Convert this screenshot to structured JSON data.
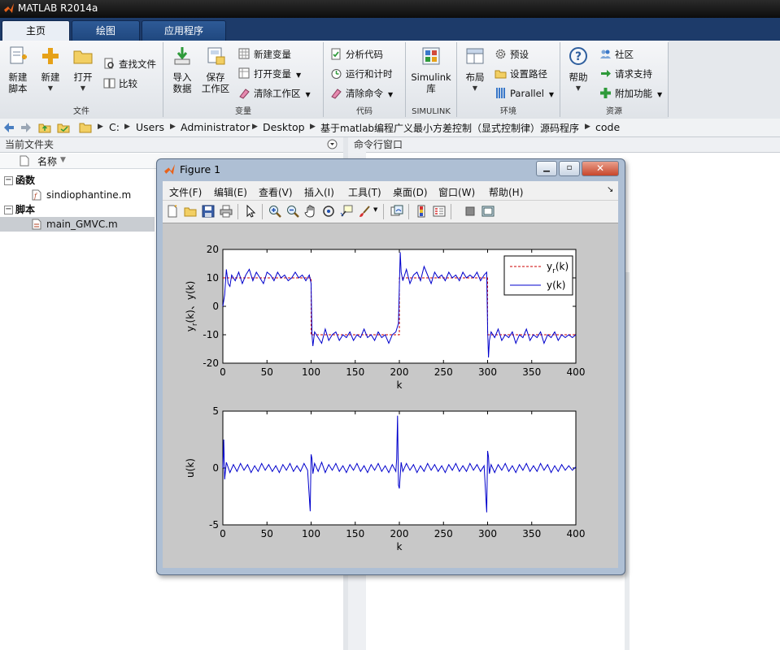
{
  "window": {
    "title": "MATLAB R2014a"
  },
  "tabs": [
    {
      "label": "主页",
      "active": true
    },
    {
      "label": "绘图",
      "active": false
    },
    {
      "label": "应用程序",
      "active": false
    }
  ],
  "ribbon": {
    "file": {
      "label": "文件",
      "new_script": [
        "新建",
        "脚本"
      ],
      "new": "新建",
      "open": "打开",
      "find_files": "查找文件",
      "compare": "比较"
    },
    "variable": {
      "label": "变量",
      "import": [
        "导入",
        "数据"
      ],
      "save": [
        "保存",
        "工作区"
      ],
      "new_var": "新建变量",
      "open_var": "打开变量",
      "clear_ws": "清除工作区"
    },
    "code": {
      "label": "代码",
      "analyze": "分析代码",
      "run_time": "运行和计时",
      "clear_cmd": "清除命令"
    },
    "simulink": {
      "label": "SIMULINK",
      "lib": [
        "Simulink",
        "库"
      ]
    },
    "env": {
      "label": "环境",
      "layout": "布局",
      "prefs": "预设",
      "set_path": "设置路径",
      "parallel": "Parallel"
    },
    "resources": {
      "label": "资源",
      "help": "帮助",
      "community": "社区",
      "support": "请求支持",
      "addons": "附加功能"
    }
  },
  "address": {
    "path": [
      "C:",
      "Users",
      "Administrator",
      "Desktop",
      "基于matlab编程广义最小方差控制（显式控制律）源码程序",
      "code"
    ]
  },
  "left_panel": {
    "title": "当前文件夹",
    "col_header": "名称",
    "groups": [
      {
        "label": "函数",
        "files": [
          "sindiophantine.m"
        ]
      },
      {
        "label": "脚本",
        "files": [
          "main_GMVC.m"
        ]
      }
    ]
  },
  "command_window": {
    "title": "命令行窗口"
  },
  "figure": {
    "title": "Figure 1",
    "menu": [
      "文件(F)",
      "编辑(E)",
      "查看(V)",
      "插入(I)",
      "工具(T)",
      "桌面(D)",
      "窗口(W)",
      "帮助(H)"
    ],
    "toolbar_icons": [
      "new-figure-icon",
      "open-file-icon",
      "save-icon",
      "print-icon",
      "select-arrow-icon",
      "zoom-in-icon",
      "zoom-out-icon",
      "pan-hand-icon",
      "rotate-3d-icon",
      "data-cursor-icon",
      "brush-icon",
      "link-plot-icon",
      "colorbar-icon",
      "legend-icon",
      "hide-tools-icon",
      "show-tools-icon"
    ]
  },
  "chart_data": [
    {
      "type": "line",
      "xlabel": "k",
      "ylabel_main": "y",
      "ylabel_sub": "r",
      "ylabel_rest": "(k)、y(k)",
      "xlim": [
        0,
        400
      ],
      "ylim": [
        -20,
        20
      ],
      "xticks": [
        0,
        50,
        100,
        150,
        200,
        250,
        300,
        350,
        400
      ],
      "yticks": [
        -20,
        -10,
        0,
        10,
        20
      ],
      "legend_position": "top-right",
      "legend": [
        {
          "main": "y",
          "sub": "r",
          "rest": "(k)",
          "style": "dashed",
          "color": "#cc0000"
        },
        {
          "main": "y(k)",
          "sub": "",
          "rest": "",
          "style": "solid",
          "color": "#0000cc"
        }
      ],
      "series": [
        {
          "name": "yr(k)",
          "color": "#cc0000",
          "style": "dashed",
          "x": [
            0,
            100,
            100,
            200,
            200,
            300,
            300,
            400
          ],
          "y": [
            10,
            10,
            -10,
            -10,
            10,
            10,
            -10,
            -10
          ]
        },
        {
          "name": "y(k)",
          "color": "#0000cc",
          "style": "solid",
          "x": [
            0,
            2,
            4,
            6,
            8,
            10,
            14,
            18,
            22,
            26,
            30,
            34,
            38,
            42,
            46,
            50,
            54,
            58,
            62,
            66,
            70,
            74,
            78,
            82,
            86,
            90,
            94,
            98,
            100,
            101,
            102,
            104,
            108,
            112,
            116,
            120,
            124,
            128,
            132,
            136,
            140,
            144,
            148,
            152,
            156,
            160,
            164,
            168,
            172,
            176,
            180,
            184,
            188,
            192,
            196,
            199,
            200,
            201,
            202,
            204,
            208,
            212,
            216,
            220,
            224,
            228,
            232,
            236,
            240,
            244,
            248,
            252,
            256,
            260,
            264,
            268,
            272,
            276,
            280,
            284,
            288,
            292,
            296,
            299,
            300,
            301,
            302,
            304,
            308,
            312,
            316,
            320,
            324,
            328,
            332,
            336,
            340,
            344,
            348,
            352,
            356,
            360,
            364,
            368,
            372,
            376,
            380,
            384,
            388,
            392,
            396,
            400
          ],
          "y": [
            0,
            4,
            13,
            8,
            7,
            11,
            9,
            12,
            8,
            11,
            13,
            9,
            12,
            10,
            8,
            12,
            11,
            9,
            12,
            10,
            11,
            9,
            10,
            12,
            10,
            11,
            9,
            11,
            8,
            -10,
            -14,
            -9,
            -11,
            -13,
            -8,
            -12,
            -10,
            -9,
            -12,
            -10,
            -11,
            -9,
            -12,
            -10,
            -11,
            -8,
            -11,
            -10,
            -12,
            -9,
            -11,
            -10,
            -13,
            -10,
            -9,
            -6,
            7,
            19,
            12,
            9,
            13,
            8,
            11,
            12,
            9,
            14,
            11,
            8,
            12,
            10,
            11,
            9,
            12,
            10,
            11,
            9,
            12,
            10,
            11,
            10,
            12,
            9,
            11,
            12,
            -8,
            -18,
            -12,
            -9,
            -11,
            -8,
            -12,
            -10,
            -11,
            -9,
            -13,
            -10,
            -11,
            -8,
            -12,
            -10,
            -11,
            -9,
            -13,
            -10,
            -11,
            -9,
            -12,
            -10,
            -11,
            -10,
            -11,
            -10
          ]
        }
      ]
    },
    {
      "type": "line",
      "xlabel": "k",
      "ylabel": "u(k)",
      "xlim": [
        0,
        400
      ],
      "ylim": [
        -5,
        5
      ],
      "xticks": [
        0,
        50,
        100,
        150,
        200,
        250,
        300,
        350,
        400
      ],
      "yticks": [
        -5,
        0,
        5
      ],
      "series": [
        {
          "name": "u(k)",
          "color": "#0000cc",
          "style": "solid",
          "x": [
            0,
            1,
            2,
            4,
            8,
            12,
            16,
            20,
            24,
            28,
            32,
            36,
            40,
            44,
            48,
            52,
            56,
            60,
            64,
            68,
            72,
            76,
            80,
            84,
            88,
            92,
            96,
            99,
            100,
            101,
            102,
            104,
            108,
            112,
            116,
            120,
            124,
            128,
            132,
            136,
            140,
            144,
            148,
            152,
            156,
            160,
            164,
            168,
            172,
            176,
            180,
            184,
            188,
            192,
            196,
            197,
            198,
            199,
            200,
            202,
            204,
            208,
            212,
            216,
            220,
            224,
            228,
            232,
            236,
            240,
            244,
            248,
            252,
            256,
            260,
            264,
            268,
            272,
            276,
            280,
            284,
            288,
            292,
            296,
            299,
            300,
            301,
            302,
            304,
            308,
            312,
            316,
            320,
            324,
            328,
            332,
            336,
            340,
            344,
            348,
            352,
            356,
            360,
            364,
            368,
            372,
            376,
            380,
            384,
            388,
            392,
            396,
            400
          ],
          "y": [
            0,
            2.5,
            -1,
            0.5,
            -0.4,
            0.3,
            -0.3,
            0.4,
            -0.2,
            0.3,
            -0.4,
            0.2,
            -0.3,
            0.4,
            -0.2,
            0.3,
            -0.3,
            0.2,
            -0.4,
            0.3,
            -0.2,
            0.4,
            -0.3,
            0.2,
            -0.3,
            0.4,
            -0.2,
            -3.8,
            1.2,
            0.8,
            -0.5,
            0.4,
            -0.3,
            0.5,
            -0.4,
            0.3,
            -0.2,
            0.4,
            -0.3,
            0.2,
            -0.4,
            0.3,
            -0.2,
            0.4,
            -0.3,
            0.2,
            -0.4,
            0.3,
            -0.2,
            0.4,
            -0.3,
            0.2,
            -0.4,
            0.3,
            -0.3,
            0.8,
            4.6,
            -1.5,
            -1.8,
            0.5,
            -0.3,
            0.4,
            -0.2,
            0.3,
            -0.4,
            0.2,
            -0.3,
            0.4,
            -0.2,
            0.3,
            -0.3,
            0.2,
            -0.4,
            0.3,
            -0.2,
            0.4,
            -0.3,
            0.2,
            -0.3,
            0.4,
            -0.2,
            0.3,
            -0.3,
            0.2,
            -3.9,
            1.5,
            1.0,
            -0.5,
            0.3,
            -0.4,
            0.3,
            -0.2,
            0.4,
            -0.3,
            0.2,
            -0.4,
            0.3,
            -0.2,
            0.4,
            -0.3,
            0.2,
            -0.3,
            0.4,
            -0.2,
            0.3,
            -0.4,
            0.2,
            -0.3,
            0.3,
            -0.2,
            0.2,
            -0.2,
            0.1
          ]
        }
      ]
    }
  ]
}
